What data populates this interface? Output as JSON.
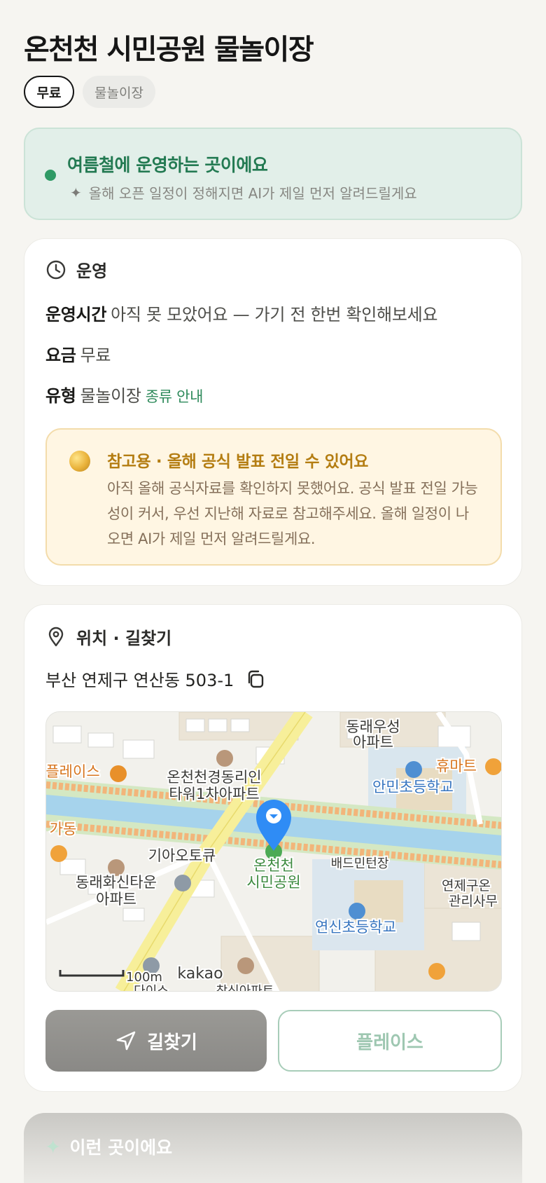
{
  "page": {
    "title": "온천천 시민공원 물놀이장",
    "chips": [
      "무료",
      "물놀이장"
    ]
  },
  "season": {
    "title": "여름철에 운영하는 곳이에요",
    "subtitle": "올해 오픈 일정이 정해지면 AI가 제일 먼저 알려드릴게요",
    "icon": "sparkle-icon"
  },
  "operation": {
    "heading": "운영",
    "rows": [
      {
        "label": "운영시간",
        "value": "아직 못 모았어요 — 가기 전 한번 확인해보세요"
      },
      {
        "label": "요금",
        "value": "무료"
      },
      {
        "label": "유형",
        "value": "물놀이장",
        "link": "종류 안내"
      }
    ],
    "notice": {
      "title": "참고용 · 올해 공식 발표 전일 수 있어요",
      "body": "아직 올해 공식자료를 확인하지 못했어요. 공식 발표 전일 가능성이 커서, 우선 지난해 자료로 참고해주세요. 올해 일정이 나오면 AI가 제일 먼저 알려드릴게요."
    }
  },
  "location": {
    "heading": "위치 · 길찾기",
    "address": "부산 연제구 연산동 503-1",
    "map": {
      "labels": {
        "apt_north": "동래우성\n아파트",
        "huemart": "휴마트",
        "place_left": "플레이스",
        "tower": "온천천경동리인\n타워1차아파트",
        "anmin_school": "안민초등학교",
        "dong_left": "가동",
        "kia": "기아오토큐",
        "park": "온천천\n시민공원",
        "badminton": "배드민턴장",
        "yeonje": "연제구온\n관리사무",
        "hwasin": "동래화신타운\n아파트",
        "yeonsin_school": "연신초등학교",
        "scale": "100m",
        "brand": "kakao",
        "daiso": "다이소",
        "chamsin": "창신아파트"
      }
    },
    "buttons": {
      "route": "길찾기",
      "place": "플레이스"
    }
  },
  "next_section": {
    "heading": "이런 곳이에요"
  },
  "colors": {
    "accent_green": "#2f9a65",
    "notice_gold": "#b47d12",
    "map_pin": "#2f8cf5",
    "river": "#a6d3ec"
  }
}
